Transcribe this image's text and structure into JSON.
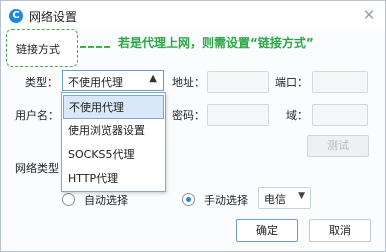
{
  "window": {
    "title": "网络设置",
    "app_icon": "C",
    "close_glyph": "✕"
  },
  "tabs": {
    "active": "链接方式"
  },
  "annotation": "若是代理上网，则需设置“链接方式”",
  "proxy": {
    "type_label": "类型：",
    "type_value": "不使用代理",
    "type_options": [
      "不使用代理",
      "使用浏览器设置",
      "SOCKS5代理",
      "HTTP代理"
    ],
    "address_label": "地址：",
    "port_label": "端口：",
    "username_label": "用户名：",
    "password_label": "密码：",
    "domain_label": "域：",
    "test_label": "测试"
  },
  "network_type": {
    "label_partial": "网络类型",
    "auto_label": "自动选择",
    "manual_label": "手动选择",
    "selected": "manual",
    "isp_value": "电信"
  },
  "buttons": {
    "ok": "确定",
    "cancel": "取消"
  },
  "colors": {
    "accent": "#1e88e5",
    "annotation_green": "#2aa745",
    "selection_blue": "#d9e8f8"
  }
}
